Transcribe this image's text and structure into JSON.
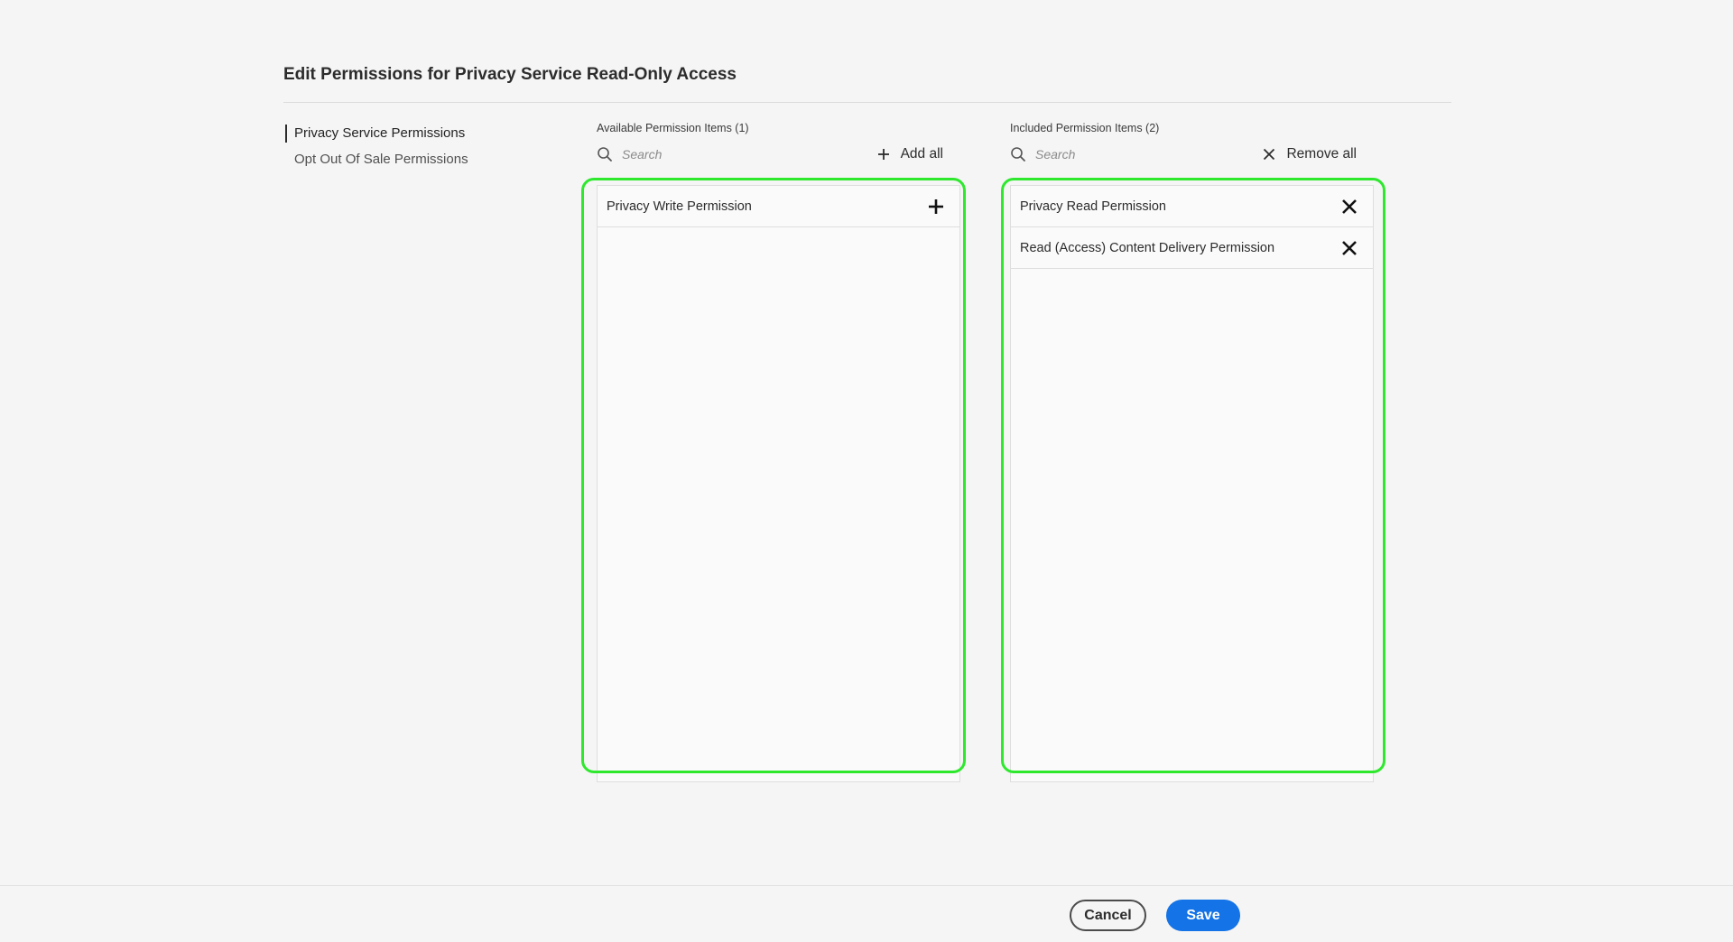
{
  "page": {
    "title": "Edit Permissions for Privacy Service Read-Only Access"
  },
  "side_nav": {
    "items": [
      {
        "label": "Privacy Service Permissions",
        "selected": true
      },
      {
        "label": "Opt Out Of Sale Permissions",
        "selected": false
      }
    ]
  },
  "available": {
    "heading": "Available Permission Items (1)",
    "search_placeholder": "Search",
    "action_label": "Add all",
    "items": [
      {
        "label": "Privacy Write Permission",
        "icon": "plus-icon"
      }
    ]
  },
  "included": {
    "heading": "Included Permission Items (2)",
    "search_placeholder": "Search",
    "action_label": "Remove all",
    "items": [
      {
        "label": "Privacy Read Permission",
        "icon": "close-icon"
      },
      {
        "label": "Read (Access) Content Delivery Permission",
        "icon": "close-icon"
      }
    ]
  },
  "footer": {
    "cancel_label": "Cancel",
    "save_label": "Save"
  },
  "colors": {
    "highlight": "#2ee82e",
    "primary_button": "#1473e6",
    "background": "#f5f5f5"
  }
}
